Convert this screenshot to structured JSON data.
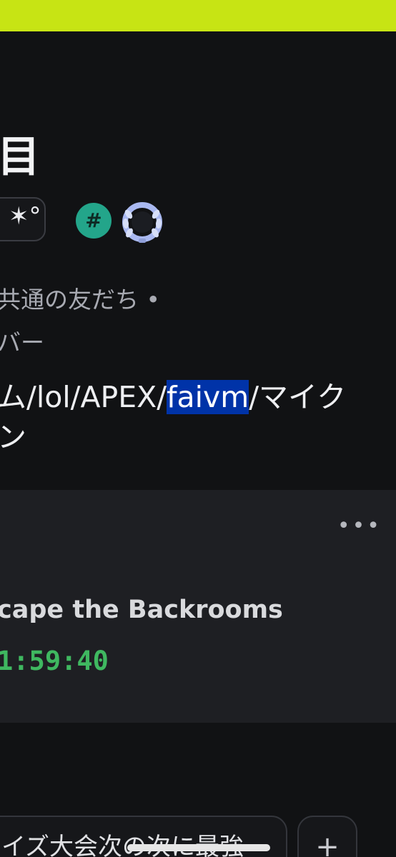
{
  "profile": {
    "name": "目",
    "tag_glyph": "✶°",
    "badges": [
      {
        "icon": "hashtag-badge-icon",
        "label": "#",
        "color": "#23a58a"
      },
      {
        "icon": "laurel-wreath-badge-icon",
        "color": "#a9b8f0"
      }
    ],
    "mutual_line1": "共通の友だち •",
    "mutual_line2": "バー",
    "bio_line1_prefix": "ム/lol/APEX/",
    "bio_line1_selected": "faivm",
    "bio_line1_suffix": "/マイク",
    "bio_line2": "ン"
  },
  "activity": {
    "more_label": "•••",
    "game_title": "cape the Backrooms",
    "elapsed": "1:59:40"
  },
  "bottom": {
    "chip_text": "イズ大会次の次に最強",
    "add_label": "+"
  },
  "colors": {
    "banner": "#c7e414",
    "background": "#111214",
    "card": "#1e1f23",
    "timer_green": "#3fb860",
    "selection": "#0033a8"
  }
}
